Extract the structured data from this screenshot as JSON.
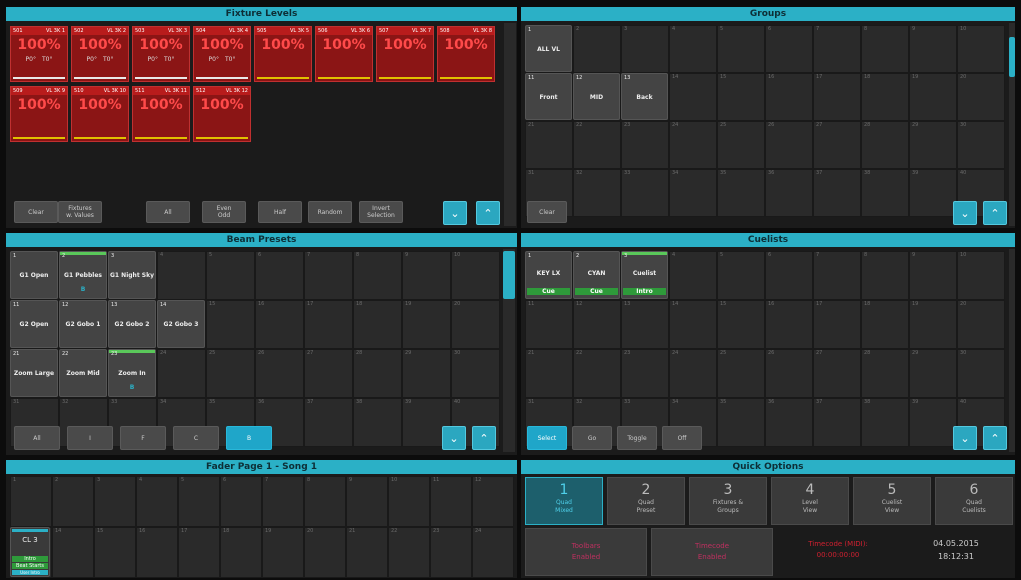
{
  "fixture_levels": {
    "title": "Fixture Levels",
    "fixtures": [
      {
        "num": "501",
        "name": "VL 3K 1",
        "level": "100%",
        "pan": "P0°",
        "tilt": "T0°",
        "bar": "white"
      },
      {
        "num": "502",
        "name": "VL 3K 2",
        "level": "100%",
        "pan": "P0°",
        "tilt": "T0°",
        "bar": "white"
      },
      {
        "num": "503",
        "name": "VL 3K 3",
        "level": "100%",
        "pan": "P0°",
        "tilt": "T0°",
        "bar": "white"
      },
      {
        "num": "504",
        "name": "VL 3K 4",
        "level": "100%",
        "pan": "P0°",
        "tilt": "T0°",
        "bar": "white"
      },
      {
        "num": "505",
        "name": "VL 3K 5",
        "level": "100%",
        "pan": "",
        "tilt": "",
        "bar": "yellow"
      },
      {
        "num": "506",
        "name": "VL 3K 6",
        "level": "100%",
        "pan": "",
        "tilt": "",
        "bar": "yellow"
      },
      {
        "num": "507",
        "name": "VL 3K 7",
        "level": "100%",
        "pan": "",
        "tilt": "",
        "bar": "yellow"
      },
      {
        "num": "508",
        "name": "VL 3K 8",
        "level": "100%",
        "pan": "",
        "tilt": "",
        "bar": "yellow"
      },
      {
        "num": "509",
        "name": "VL 3K 9",
        "level": "100%",
        "pan": "",
        "tilt": "",
        "bar": "yellow"
      },
      {
        "num": "510",
        "name": "VL 3K 10",
        "level": "100%",
        "pan": "",
        "tilt": "",
        "bar": "yellow"
      },
      {
        "num": "511",
        "name": "VL 3K 11",
        "level": "100%",
        "pan": "",
        "tilt": "",
        "bar": "yellow"
      },
      {
        "num": "512",
        "name": "VL 3K 12",
        "level": "100%",
        "pan": "",
        "tilt": "",
        "bar": "yellow"
      }
    ],
    "buttons": [
      "Clear",
      "Fixtures\nw. Values",
      "All",
      "Even\nOdd",
      "Half",
      "Random",
      "Invert\nSelection"
    ]
  },
  "groups": {
    "title": "Groups",
    "tiles": [
      {
        "num": "1",
        "label": "ALL VL"
      },
      {
        "num": "11",
        "label": "Front"
      },
      {
        "num": "12",
        "label": "MID"
      },
      {
        "num": "13",
        "label": "Back"
      }
    ],
    "buttons": [
      "Clear"
    ]
  },
  "beam_presets": {
    "title": "Beam Presets",
    "tiles": [
      {
        "num": "1",
        "label": "G1 Open"
      },
      {
        "num": "2",
        "label": "G1 Pebbles",
        "sub": "B"
      },
      {
        "num": "3",
        "label": "G1 Night Sky"
      },
      {
        "num": "11",
        "label": "G2 Open"
      },
      {
        "num": "12",
        "label": "G2 Gobo 1"
      },
      {
        "num": "13",
        "label": "G2 Gobo 2"
      },
      {
        "num": "14",
        "label": "G2 Gobo 3"
      },
      {
        "num": "21",
        "label": "Zoom Large"
      },
      {
        "num": "22",
        "label": "Zoom Mid"
      },
      {
        "num": "23",
        "label": "Zoom In",
        "sub": "B"
      }
    ],
    "buttons": [
      "All",
      "I",
      "F",
      "C",
      "B"
    ],
    "active_button": "B"
  },
  "cuelists": {
    "title": "Cuelists",
    "tiles": [
      {
        "num": "1",
        "label": "KEY LX",
        "status": "Cue"
      },
      {
        "num": "2",
        "label": "CYAN",
        "status": "Cue"
      },
      {
        "num": "3",
        "label": "Cuelist",
        "status": "Intro"
      }
    ],
    "buttons": [
      "Select",
      "Go",
      "Toggle",
      "Off"
    ],
    "active_button": "Select"
  },
  "fader_page": {
    "title": "Fader Page 1 - Song 1",
    "fader": {
      "label": "CL 3",
      "status1": "Intro",
      "status2": "Beat Starts",
      "status3": "User Intro"
    }
  },
  "quick_options": {
    "title": "Quick Options",
    "options": [
      {
        "num": "1",
        "label": "Quad\nMixed",
        "active": true
      },
      {
        "num": "2",
        "label": "Quad\nPreset",
        "active": false
      },
      {
        "num": "3",
        "label": "Fixtures &\nGroups",
        "active": false
      },
      {
        "num": "4",
        "label": "Level\nView",
        "active": false
      },
      {
        "num": "5",
        "label": "Cuelist\nView",
        "active": false
      },
      {
        "num": "6",
        "label": "Quad\nCuelists",
        "active": false
      }
    ],
    "toolbars": "Toolbars\nEnabled",
    "timecode": "Timecode\nEnabled",
    "timecode_midi_label": "Timecode (MIDI):",
    "timecode_midi_value": "00:00:00:00",
    "date": "04.05.2015",
    "time": "18:12:31"
  },
  "colors": {
    "accent": "#2bb0c6",
    "fixture_red": "#b81c1c",
    "cue_green": "#2e9a3a"
  }
}
